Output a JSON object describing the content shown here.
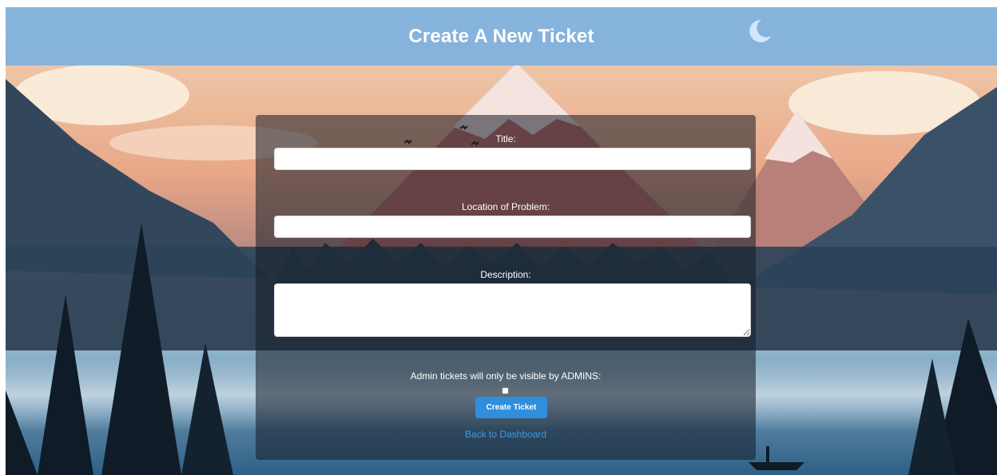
{
  "header": {
    "title": "Create A New Ticket"
  },
  "form": {
    "title_label": "Title:",
    "title_value": "",
    "location_label": "Location of Problem:",
    "location_value": "",
    "description_label": "Description:",
    "description_value": "",
    "admin_note": "Admin tickets will only be visible by ADMINS:",
    "admin_checked": false,
    "submit_label": "Create Ticket",
    "back_link": "Back to Dashboard"
  },
  "colors": {
    "header_bg": "#78afe1",
    "button_bg": "#2f8fdc",
    "link": "#3a9ae8"
  },
  "icons": {
    "moon": "crescent-moon-icon",
    "birds": "bird-icon"
  }
}
